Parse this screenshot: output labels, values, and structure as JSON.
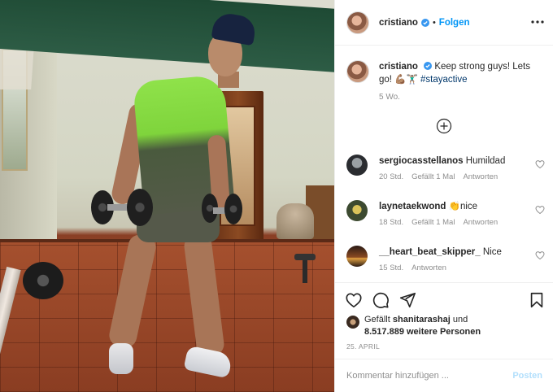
{
  "post": {
    "username": "cristiano",
    "follow_label": "Folgen",
    "caption_text": "Keep strong guys! Lets go! 💪🏽🏋🏽‍♂️",
    "hashtag": "#stayactive",
    "caption_time": "5 Wo."
  },
  "comments": [
    {
      "username": "sergiocasstellanos",
      "text": "Humildad",
      "time": "20 Std.",
      "likes": "Gefällt 1 Mal",
      "reply_label": "Antworten"
    },
    {
      "username": "laynetaekwond",
      "text": "👏nice",
      "time": "18 Std.",
      "likes": "Gefällt 1 Mal",
      "reply_label": "Antworten"
    },
    {
      "username": "__heart_beat_skipper_",
      "text": "Nice",
      "time": "15 Std.",
      "reply_label": "Antworten"
    }
  ],
  "likes_block": {
    "prefix": "Gefällt",
    "liker": "shanitarashaj",
    "mid": "und",
    "count": "8.517.889",
    "suffix": "weitere Personen"
  },
  "date": "25. APRIL",
  "comment_input": {
    "placeholder": "Kommentar hinzufügen ...",
    "post_label": "Posten"
  },
  "colors": {
    "link_blue": "#0095f6",
    "hashtag": "#00376b",
    "muted": "#8e8e8e",
    "verified": "#3897f0"
  },
  "icons": [
    "more-options-icon",
    "verified-icon",
    "add-circle-icon",
    "heart-icon",
    "comment-icon",
    "share-icon",
    "bookmark-icon"
  ]
}
